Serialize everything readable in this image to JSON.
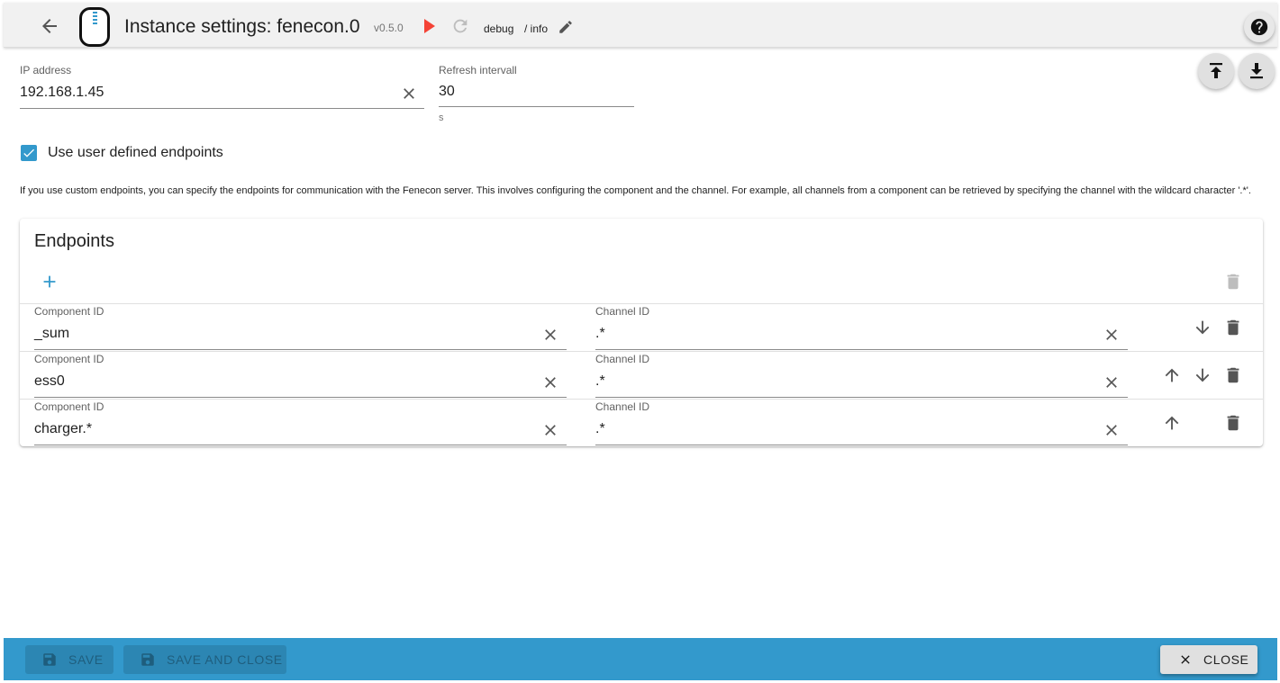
{
  "header": {
    "title": "Instance settings:  fenecon.0",
    "version": "v0.5.0",
    "log_level": "debug",
    "log_separator": "/ info",
    "icons": {
      "back": "arrow-left-icon",
      "play": "play-icon",
      "reload": "reload-icon",
      "edit": "pencil-icon",
      "help": "help-circle-icon"
    },
    "accent_color": "#3399cc",
    "play_color": "#f44336"
  },
  "settings": {
    "ip_address": {
      "label": "IP address",
      "value": "192.168.1.45"
    },
    "refresh_interval": {
      "label": "Refresh intervall",
      "value": "30",
      "unit": "s"
    },
    "use_custom_endpoints": {
      "label": "Use user defined endpoints",
      "checked": true
    },
    "description": "If you use custom endpoints, you can specify the endpoints for communication with the Fenecon server. This involves configuring the component and the channel. For example, all channels from a component can be retrieved by specifying the channel with the wildcard character '.*'."
  },
  "endpoints": {
    "title": "Endpoints",
    "rows": [
      {
        "component_label": "Component ID",
        "component_value": "_sum",
        "channel_label": "Channel ID",
        "channel_value": ".*"
      },
      {
        "component_label": "Component ID",
        "component_value": "ess0",
        "channel_label": "Channel ID",
        "channel_value": ".*"
      },
      {
        "component_label": "Component ID",
        "component_value": "charger.*",
        "channel_label": "Channel ID",
        "channel_value": ".*"
      }
    ]
  },
  "footer": {
    "save_label": "Save",
    "save_close_label": "Save and close",
    "close_label": "Close",
    "background_color": "#3399cc"
  }
}
